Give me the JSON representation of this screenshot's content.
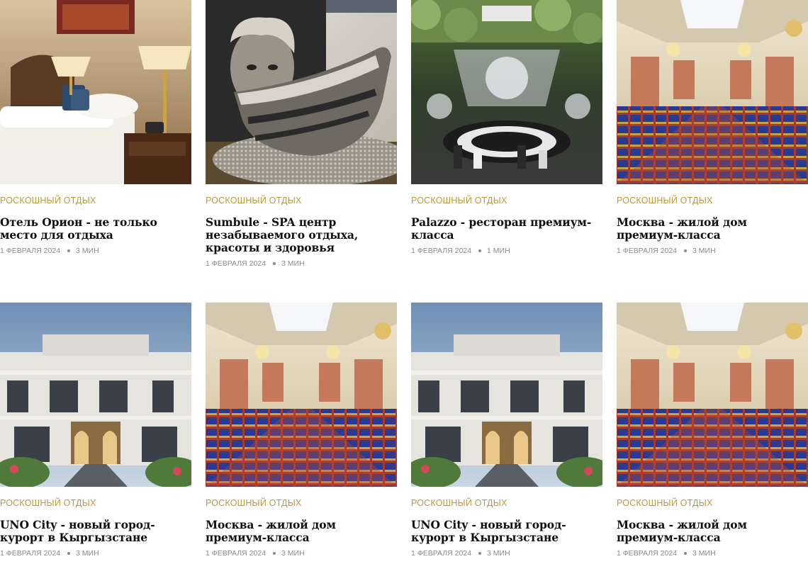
{
  "articles": [
    {
      "category": "РОСКОШНЫЙ ОТДЫХ",
      "title": "Отель Орион - не только место для отдыха",
      "date": "1 ФЕВРАЛЯ 2024",
      "read_time": "3 МИН",
      "image": "hotel-bedroom"
    },
    {
      "category": "РОСКОШНЫЙ ОТДЫХ",
      "title": "Sumbule - SPA центр незабываемого отдыха, красоты и здоровья",
      "date": "1 ФЕВРАЛЯ 2024",
      "read_time": "3 МИН",
      "image": "spa-bathtub"
    },
    {
      "category": "РОСКОШНЫЙ ОТДЫХ",
      "title": "Palazzo - ресторан премиум-класса",
      "date": "1 ФЕВРАЛЯ 2024",
      "read_time": "1 МИН",
      "image": "restaurant-hall"
    },
    {
      "category": "РОСКОШНЫЙ ОТДЫХ",
      "title": "Москва - жилой дом премиум-класса",
      "date": "1 ФЕВРАЛЯ 2024",
      "read_time": "3 МИН",
      "image": "conference-hall"
    },
    {
      "category": "РОСКОШНЫЙ ОТДЫХ",
      "title": "UNO City - новый город-курорт в Кыргызстане",
      "date": "1 ФЕВРАЛЯ 2024",
      "read_time": "3 МИН",
      "image": "building-facade"
    },
    {
      "category": "РОСКОШНЫЙ ОТДЫХ",
      "title": "Москва - жилой дом премиум-класса",
      "date": "1 ФЕВРАЛЯ 2024",
      "read_time": "3 МИН",
      "image": "conference-hall"
    },
    {
      "category": "РОСКОШНЫЙ ОТДЫХ",
      "title": "UNO City - новый город-курорт в Кыргызстане",
      "date": "1 ФЕВРАЛЯ 2024",
      "read_time": "3 МИН",
      "image": "building-facade"
    },
    {
      "category": "РОСКОШНЫЙ ОТДЫХ",
      "title": "Москва - жилой дом премиум-класса",
      "date": "1 ФЕВРАЛЯ 2024",
      "read_time": "3 МИН",
      "image": "conference-hall"
    }
  ],
  "colors": {
    "category": "#b89a3e",
    "title": "#111111",
    "meta": "#8a8a8a"
  }
}
